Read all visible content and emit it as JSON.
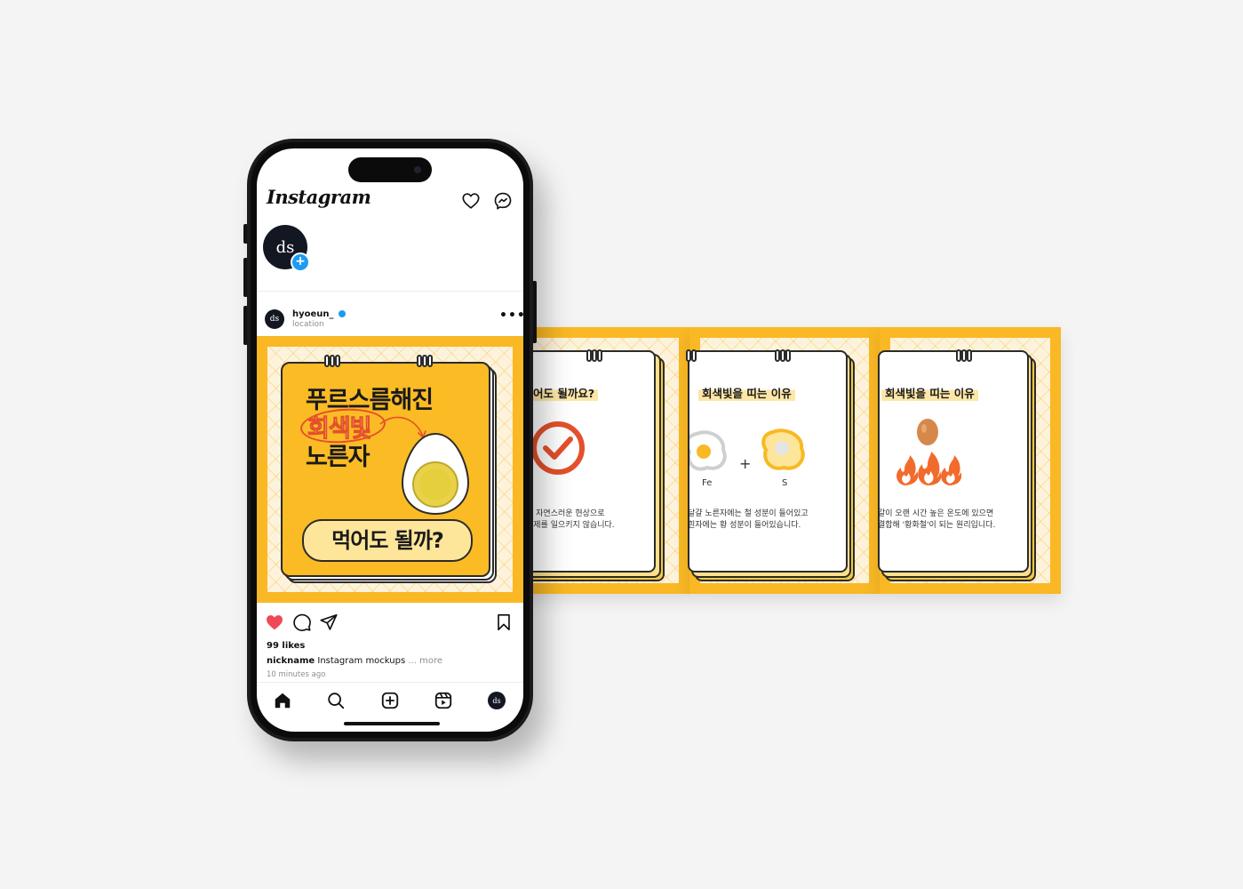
{
  "app": {
    "logo_text": "Instagram"
  },
  "header": {
    "icons": [
      "heart-outline-icon",
      "messenger-icon"
    ]
  },
  "story": {
    "avatar_text": "ds",
    "add_icon": "+"
  },
  "post": {
    "username": "hyoeun_",
    "location": "location",
    "more_icon": "•••",
    "avatar_text": "ds",
    "card": {
      "line1": "푸르스름해진",
      "line2": "회색빛",
      "line3": "노른자",
      "question": "먹어도 될까?"
    },
    "likes": "99 likes",
    "caption_user": "nickname",
    "caption_text": "Instagram mockups",
    "caption_more": "... more",
    "time": "10 minutes ago"
  },
  "carousel": [
    {
      "title": "어도 될까요?",
      "line1": "한 자연스러운 현상으로",
      "line2": "문제를 일으키지 않습니다."
    },
    {
      "title": "회색빛을 띠는 이유",
      "label_a": "Fe",
      "plus": "+",
      "label_b": "S",
      "line1": "달걀 노른자에는 철 성분이 들어있고",
      "line2": "흰자에는 황 성분이 들어있습니다."
    },
    {
      "title": "회색빛을 띠는 이유",
      "line1": "갈이 오랜 시간 높은 온도에 있으면",
      "line2": "결합해 '황화철'이 되는 원리입니다."
    }
  ],
  "bottom_nav": {
    "avatar_text": "ds"
  },
  "colors": {
    "accent": "#f9b824",
    "like": "#ed4956",
    "verified": "#1d9bf0",
    "check": "#e4502a"
  }
}
